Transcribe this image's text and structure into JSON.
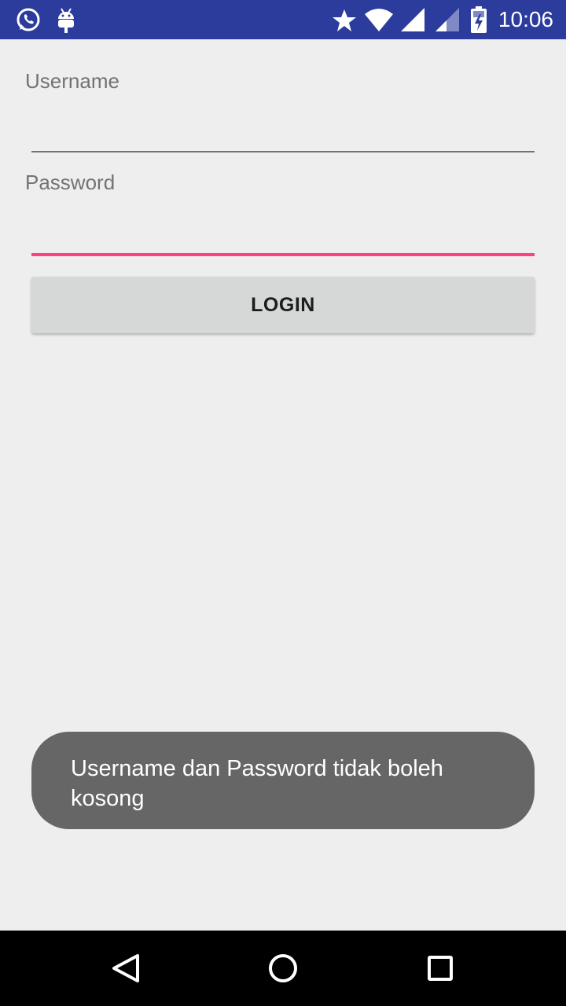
{
  "status_bar": {
    "time": "10:06",
    "left_icons": [
      "whatsapp-icon",
      "android-debug-icon"
    ],
    "right_icons": [
      "star-icon",
      "wifi-icon",
      "signal-icon",
      "signal-weak-icon",
      "battery-charging-icon"
    ],
    "background": "#2c3c9c"
  },
  "form": {
    "username_label": "Username",
    "username_value": "",
    "password_label": "Password",
    "password_value": "",
    "login_button": "LOGIN",
    "accent_color": "#ff4081"
  },
  "toast": {
    "message": "Username dan Password tidak boleh kosong"
  },
  "navigation": {
    "buttons": [
      "back-icon",
      "home-icon",
      "recents-icon"
    ]
  }
}
